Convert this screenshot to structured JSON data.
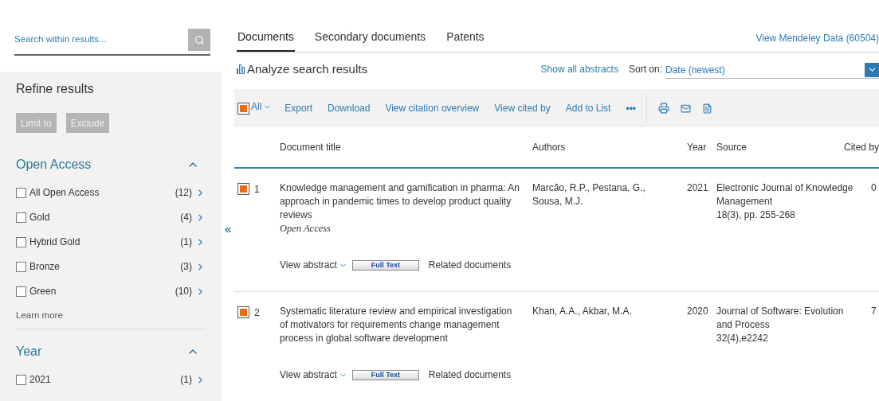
{
  "sidebar": {
    "search": {
      "placeholder": "Search within results..."
    },
    "title": "Refine results",
    "buttons": [
      {
        "label": "Limit to",
        "disabled": true
      },
      {
        "label": "Exclude",
        "disabled": true
      }
    ],
    "groups": [
      {
        "title": "Open Access",
        "expanded": true,
        "items": [
          {
            "label": "All Open Access",
            "count": "(12)",
            "checked": false
          },
          {
            "label": "Gold",
            "count": "(4)",
            "checked": false
          },
          {
            "label": "Hybrid Gold",
            "count": "(1)",
            "checked": false
          },
          {
            "label": "Bronze",
            "count": "(3)",
            "checked": false
          },
          {
            "label": "Green",
            "count": "(10)",
            "checked": false
          }
        ],
        "link": "Learn more"
      },
      {
        "title": "Year",
        "expanded": true,
        "items": [
          {
            "label": "2021",
            "count": "(1)",
            "checked": false
          }
        ]
      }
    ]
  },
  "tabs": [
    {
      "label": "Documents",
      "selected": true
    },
    {
      "label": "Secondary documents",
      "selected": false
    },
    {
      "label": "Patents",
      "selected": false
    }
  ],
  "mendeley_link": "View Mendeley Data (60504)",
  "analyze": "Analyze search results",
  "show_abstracts": "Show all abstracts",
  "sort": {
    "label": "Sort on:",
    "value": "Date (newest)"
  },
  "toolbar": {
    "select_all": {
      "label": "All",
      "checked": true
    },
    "actions": [
      "Export",
      "Download",
      "View citation overview",
      "View cited by",
      "Add to List",
      "•••"
    ]
  },
  "table": {
    "columns": [
      "Document title",
      "Authors",
      "Year",
      "Source",
      "Cited by"
    ],
    "rows": [
      {
        "number": "1",
        "checked": true,
        "title": "Knowledge management and gamification in pharma: An approach in pandemic times to develop product quality reviews",
        "access": "Open Access",
        "authors": "Marcão, R.P., Pestana, G., Sousa, M.J.",
        "year": "2021",
        "source": [
          "Electronic Journal of Knowledge Management",
          "18(3), pp. 255-268"
        ],
        "cited_by": "0",
        "actions": {
          "abstract": "View abstract",
          "full_text": "Full Text",
          "related": "Related documents"
        }
      },
      {
        "number": "2",
        "checked": true,
        "title": "Systematic literature review and empirical investigation of motivators for requirements change management process in global software development",
        "authors": "Khan, A.A., Akbar, M.A.",
        "year": "2020",
        "source": [
          "Journal of Software: Evolution and Process",
          "32(4),e2242"
        ],
        "cited_by": "7",
        "actions": {
          "abstract": "View abstract",
          "full_text": "Full Text",
          "related": "Related documents"
        }
      }
    ]
  }
}
